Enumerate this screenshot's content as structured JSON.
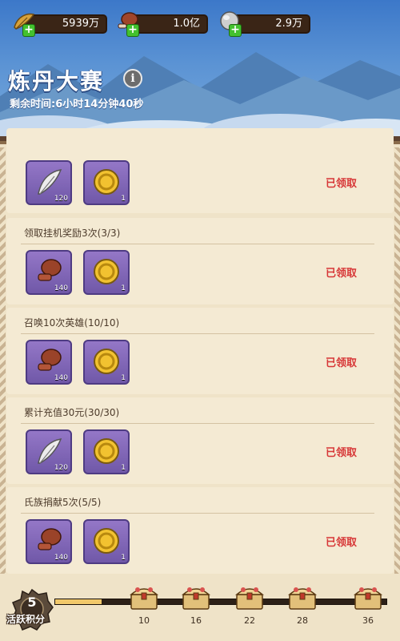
{
  "resources": [
    {
      "icon": "feather-icon",
      "value": "5939万"
    },
    {
      "icon": "meat-icon",
      "value": "1.0亿"
    },
    {
      "icon": "stone-icon",
      "value": "2.9万"
    }
  ],
  "event": {
    "title": "炼丹大赛",
    "timer": "剩余时间:6小时14分钟40秒"
  },
  "tasks": [
    {
      "label": "",
      "rewards": [
        {
          "icon": "feather-icon",
          "count": "120"
        },
        {
          "icon": "gold-coin-icon",
          "count": "1"
        }
      ],
      "status": "已领取"
    },
    {
      "label": "领取挂机奖励3次(3/3)",
      "rewards": [
        {
          "icon": "meat-icon",
          "count": "140"
        },
        {
          "icon": "gold-coin-icon",
          "count": "1"
        }
      ],
      "status": "已领取"
    },
    {
      "label": "召唤10次英雄(10/10)",
      "rewards": [
        {
          "icon": "meat-icon",
          "count": "140"
        },
        {
          "icon": "gold-coin-icon",
          "count": "1"
        }
      ],
      "status": "已领取"
    },
    {
      "label": "累计充值30元(30/30)",
      "rewards": [
        {
          "icon": "feather-icon",
          "count": "120"
        },
        {
          "icon": "gold-coin-icon",
          "count": "1"
        }
      ],
      "status": "已领取"
    },
    {
      "label": "氏族捐献5次(5/5)",
      "rewards": [
        {
          "icon": "meat-icon",
          "count": "140"
        },
        {
          "icon": "gold-coin-icon",
          "count": "1"
        }
      ],
      "status": "已领取"
    }
  ],
  "progress": {
    "score": "5",
    "score_label": "活跃积分",
    "fill_fraction": 0.14,
    "milestones": [
      "10",
      "16",
      "22",
      "28",
      "36"
    ]
  }
}
